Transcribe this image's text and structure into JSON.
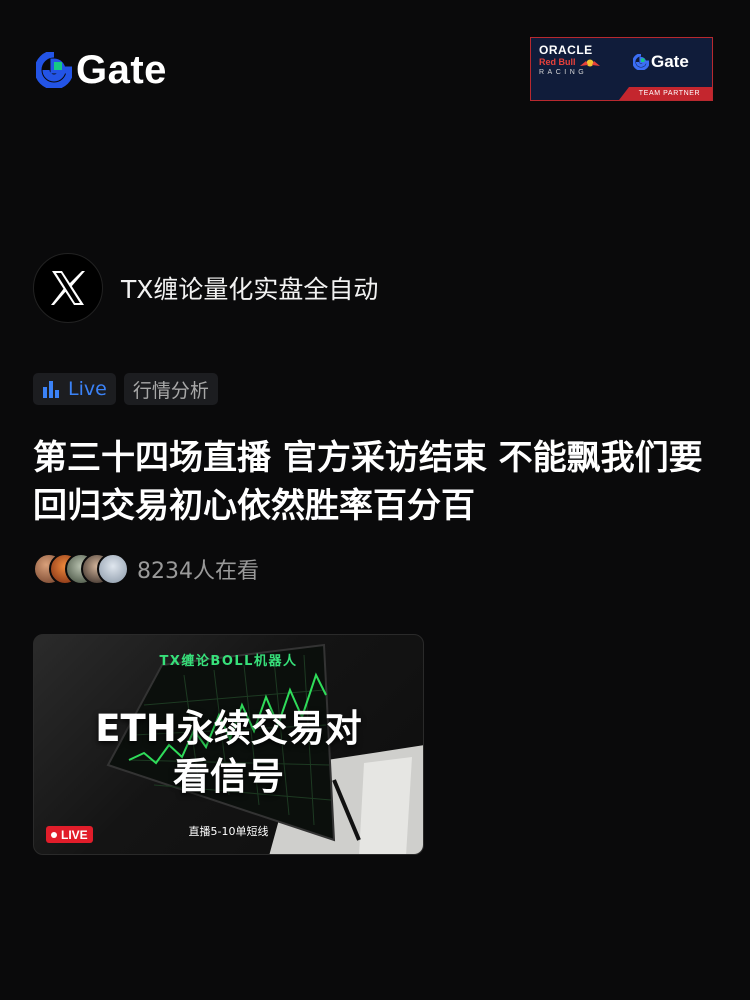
{
  "header": {
    "brand_name": "Gate",
    "brand_color": "#2354e6",
    "brand_accent": "#16c784"
  },
  "partner_badge": {
    "line1": "ORACLE",
    "line2": "Red Bull",
    "line3": "RACING",
    "brand": "Gate",
    "strip": "TEAM PARTNER"
  },
  "host": {
    "avatar_icon": "x-logo-icon",
    "name": "TX缠论量化实盘全自动"
  },
  "tags": {
    "live_label": "Live",
    "live_icon": "bar-chart-icon",
    "category": "行情分析"
  },
  "stream": {
    "title": "第三十四场直播 官方采访结束 不能飘我们要回归交易初心依然胜率百分百",
    "viewer_count": "8234人在看"
  },
  "thumbnail": {
    "top_text": "TX缠论BOLL机器人",
    "main_line1": "ETH永续交易对",
    "main_line2": "看信号",
    "sub_text": "直播5-10单短线",
    "live_badge": "LIVE"
  }
}
